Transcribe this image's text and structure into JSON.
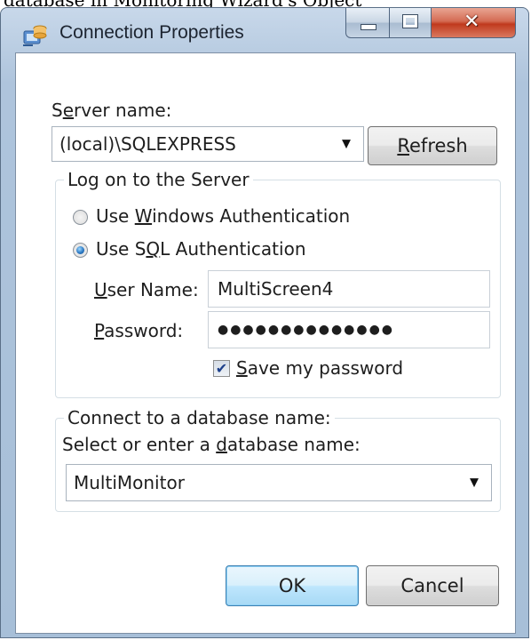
{
  "background_text": "database in Monitoring Wizard's Object",
  "window": {
    "title": "Connection Properties",
    "title_icon": "connection-properties-icon",
    "buttons": {
      "minimize": "minimize-icon",
      "maximize": "maximize-icon",
      "close": "close-icon"
    }
  },
  "server": {
    "label_pre": "S",
    "label_acc": "e",
    "label_post": "rver name:",
    "value": "(local)\\SQLEXPRESS",
    "refresh_acc": "R",
    "refresh_post": "efresh"
  },
  "logon_group": {
    "legend": "Log on to the Server",
    "windows_auth_pre": "Use ",
    "windows_auth_acc": "W",
    "windows_auth_post": "indows Authentication",
    "sql_auth_pre": "Use S",
    "sql_auth_acc": "Q",
    "sql_auth_post": "L Authentication",
    "selected": "sql",
    "username_acc": "U",
    "username_post": "ser Name:",
    "username_value": "MultiScreen4",
    "password_acc": "P",
    "password_post": "assword:",
    "password_value": "●●●●●●●●●●●●●●",
    "save_acc": "S",
    "save_post": "ave my password",
    "save_checked": true,
    "check_glyph": "✔"
  },
  "database_group": {
    "legend": "Connect to a database name:",
    "prompt_pre": "Select or enter a ",
    "prompt_acc": "d",
    "prompt_post": "atabase name:",
    "value": "MultiMonitor"
  },
  "footer": {
    "ok": "OK",
    "cancel": "Cancel"
  },
  "colors": {
    "accent": "#3c7fb1",
    "title_bar": "#aec4dc",
    "close_button": "#c0391d"
  }
}
